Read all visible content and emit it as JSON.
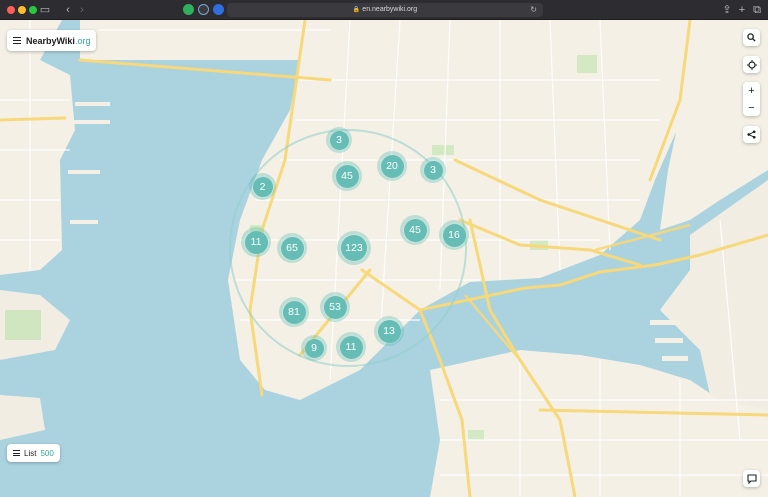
{
  "browser": {
    "url": "en.nearbywiki.org",
    "lock_icon": "lock-icon"
  },
  "app": {
    "name": "NearbyWiki",
    "domain": ".org"
  },
  "list": {
    "label": "List",
    "count": "500"
  },
  "controls": {
    "search_icon": "search-icon",
    "locate_icon": "crosshair-icon",
    "zoom_in": "+",
    "zoom_out": "−",
    "share_icon": "share-icon",
    "feedback_icon": "chat-icon"
  },
  "clusters": [
    {
      "count": "3"
    },
    {
      "count": "20"
    },
    {
      "count": "45"
    },
    {
      "count": "3"
    },
    {
      "count": "2"
    },
    {
      "count": "11"
    },
    {
      "count": "65"
    },
    {
      "count": "123"
    },
    {
      "count": "45"
    },
    {
      "count": "16"
    },
    {
      "count": "81"
    },
    {
      "count": "53"
    },
    {
      "count": "13"
    },
    {
      "count": "9"
    },
    {
      "count": "11"
    }
  ],
  "colors": {
    "water": "#aad3df",
    "land": "#f4f0e6",
    "park": "#d3e9c4",
    "major_road": "#f7d87a",
    "cluster": "#66bdb5",
    "accent": "#2fa79c"
  }
}
